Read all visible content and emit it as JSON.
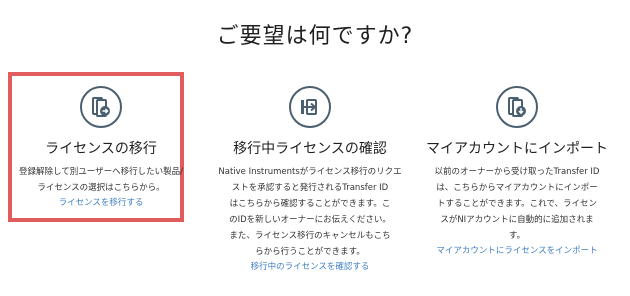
{
  "page": {
    "title": "ご要望は何ですか?"
  },
  "options": [
    {
      "icon": "license-transfer-icon",
      "title": "ライセンスの移行",
      "description_lines": [
        "登録解除して別ユーザーへ移行したい製品/",
        "ライセンスの選択はこちらから。"
      ],
      "link": "ライセンスを移行する"
    },
    {
      "icon": "transfer-in-progress-icon",
      "title": "移行中ライセンスの確認",
      "description_lines": [
        "Native Instrumentsがライセンス移行のリクエ",
        "ストを承認すると発行されるTransfer ID",
        "はこちらから確認することができます。こ",
        "のIDを新しいオーナーにお伝えください。",
        "また、ライセンス移行のキャンセルもこち",
        "らから行うことができます。"
      ],
      "link": "移行中のライセンスを確認する"
    },
    {
      "icon": "account-import-icon",
      "title": "マイアカウントにインポート",
      "description_lines": [
        "以前のオーナーから受け取ったTransfer ID",
        "は、こちらからマイアカウントにインポー",
        "トすることができます。これで、ライセン",
        "スがNIアカウントに自動的に追加されま",
        "す。"
      ],
      "link": "マイアカウントにライセンスをインポート"
    }
  ],
  "colors": {
    "accent_link": "#3f7fc4",
    "icon_stroke": "#4a6071",
    "highlight": "#e15c5c"
  }
}
